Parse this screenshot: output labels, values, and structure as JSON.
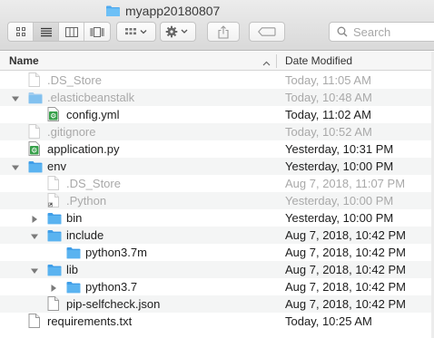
{
  "window": {
    "title": "myapp20180807"
  },
  "toolbar": {
    "search_placeholder": "Search"
  },
  "columns": {
    "name": "Name",
    "date_modified": "Date Modified"
  },
  "files": [
    {
      "name": ".DS_Store",
      "date": "Today, 11:05 AM",
      "level": 0,
      "type": "file",
      "dim": true,
      "disclosure": "none"
    },
    {
      "name": ".elasticbeanstalk",
      "date": "Today, 10:48 AM",
      "level": 0,
      "type": "folder",
      "dim": true,
      "disclosure": "open"
    },
    {
      "name": "config.yml",
      "date": "Today, 11:02 AM",
      "level": 1,
      "type": "script",
      "dim": false,
      "disclosure": "none"
    },
    {
      "name": ".gitignore",
      "date": "Today, 10:52 AM",
      "level": 0,
      "type": "file",
      "dim": true,
      "disclosure": "none"
    },
    {
      "name": "application.py",
      "date": "Yesterday, 10:31 PM",
      "level": 0,
      "type": "script",
      "dim": false,
      "disclosure": "none"
    },
    {
      "name": "env",
      "date": "Yesterday, 10:00 PM",
      "level": 0,
      "type": "folder",
      "dim": false,
      "disclosure": "open"
    },
    {
      "name": ".DS_Store",
      "date": "Aug 7, 2018, 11:07 PM",
      "level": 1,
      "type": "file",
      "dim": true,
      "disclosure": "none"
    },
    {
      "name": ".Python",
      "date": "Yesterday, 10:00 PM",
      "level": 1,
      "type": "alias",
      "dim": true,
      "disclosure": "none"
    },
    {
      "name": "bin",
      "date": "Yesterday, 10:00 PM",
      "level": 1,
      "type": "folder",
      "dim": false,
      "disclosure": "closed"
    },
    {
      "name": "include",
      "date": "Aug 7, 2018, 10:42 PM",
      "level": 1,
      "type": "folder",
      "dim": false,
      "disclosure": "open"
    },
    {
      "name": "python3.7m",
      "date": "Aug 7, 2018, 10:42 PM",
      "level": 2,
      "type": "folder",
      "dim": false,
      "disclosure": "none"
    },
    {
      "name": "lib",
      "date": "Aug 7, 2018, 10:42 PM",
      "level": 1,
      "type": "folder",
      "dim": false,
      "disclosure": "open"
    },
    {
      "name": "python3.7",
      "date": "Aug 7, 2018, 10:42 PM",
      "level": 2,
      "type": "folder",
      "dim": false,
      "disclosure": "closed"
    },
    {
      "name": "pip-selfcheck.json",
      "date": "Aug 7, 2018, 10:42 PM",
      "level": 1,
      "type": "file",
      "dim": false,
      "disclosure": "none"
    },
    {
      "name": "requirements.txt",
      "date": "Today, 10:25 AM",
      "level": 0,
      "type": "file",
      "dim": false,
      "disclosure": "none"
    }
  ],
  "icons": {
    "folder_color": "#5ab3f0",
    "script_color": "#37a04a"
  }
}
